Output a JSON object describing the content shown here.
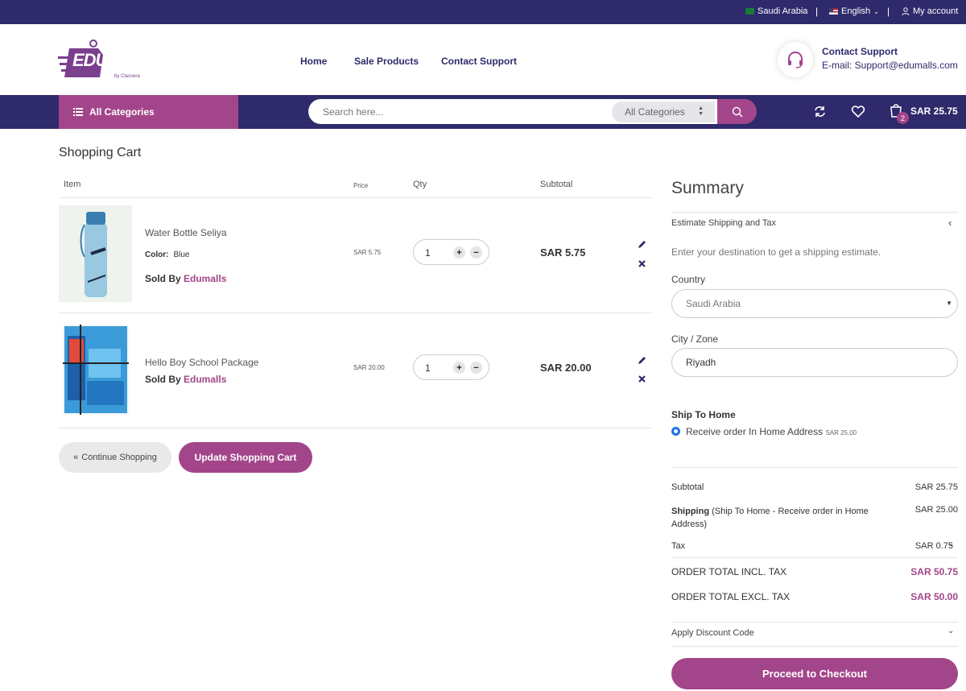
{
  "topbar": {
    "country": "Saudi Arabia",
    "language": "English",
    "account": "My account"
  },
  "header": {
    "logo_text": "EDU malls",
    "logo_sub": "by Classera",
    "nav": [
      "Home",
      "Sale Products",
      "Contact Support"
    ],
    "support_title": "Contact Support",
    "support_email": "E-mail: Support@edumalls.com"
  },
  "navbar": {
    "all_categories": "All Categories",
    "search_placeholder": "Search here...",
    "search_category": "All Categories",
    "cart_count": "2",
    "cart_total": "SAR 25.75"
  },
  "cart": {
    "title": "Shopping Cart",
    "columns": {
      "item": "Item",
      "price": "Price",
      "qty": "Qty",
      "subtotal": "Subtotal"
    },
    "items": [
      {
        "name": "Water Bottle Seliya",
        "color_label": "Color:",
        "color": "Blue",
        "sold_by_label": "Sold By",
        "seller": "Edumalls",
        "price": "SAR 5.75",
        "qty": "1",
        "subtotal": "SAR 5.75"
      },
      {
        "name": "Hello Boy School Package",
        "sold_by_label": "Sold By",
        "seller": "Edumalls",
        "price": "SAR 20.00",
        "qty": "1",
        "subtotal": "SAR 20.00"
      }
    ],
    "continue_label": "Continue Shopping",
    "update_label": "Update Shopping Cart"
  },
  "summary": {
    "title": "Summary",
    "estimate_label": "Estimate Shipping and Tax",
    "estimate_hint": "Enter your destination to get a shipping estimate.",
    "country_label": "Country",
    "country_value": "Saudi Arabia",
    "city_label": "City / Zone",
    "city_value": "Riyadh",
    "ship_title": "Ship To Home",
    "ship_option": "Receive order In Home Address",
    "ship_option_price": "SAR 25.00",
    "subtotal_label": "Subtotal",
    "subtotal_value": "SAR 25.75",
    "shipping_label": "Shipping",
    "shipping_detail": "(Ship To Home - Receive order in Home Address)",
    "shipping_value": "SAR 25.00",
    "tax_label": "Tax",
    "tax_value": "SAR 0.75",
    "total_incl_label": "ORDER TOTAL INCL. TAX",
    "total_incl_value": "SAR 50.75",
    "total_excl_label": "ORDER TOTAL EXCL. TAX",
    "total_excl_value": "SAR 50.00",
    "discount_label": "Apply Discount Code",
    "checkout_label": "Proceed to Checkout"
  },
  "colors": {
    "primary": "#2e2a6b",
    "accent": "#a3458a"
  }
}
